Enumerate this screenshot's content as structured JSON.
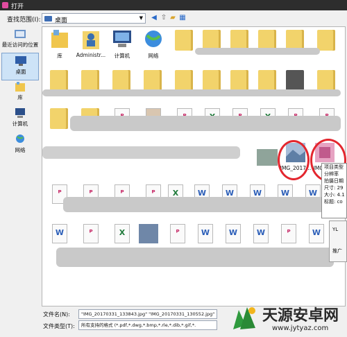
{
  "window": {
    "title": "打开"
  },
  "toolbar": {
    "look_in_label": "查找范围(I):",
    "look_in_value": "桌面",
    "icons": [
      "back-icon",
      "up-folder-icon",
      "new-folder-icon",
      "view-menu-icon"
    ]
  },
  "places": [
    {
      "label": "最近访问的位置",
      "icon": "recent-places-icon"
    },
    {
      "label": "桌面",
      "icon": "desktop-icon",
      "selected": true
    },
    {
      "label": "库",
      "icon": "libraries-icon"
    },
    {
      "label": "计算机",
      "icon": "computer-icon"
    },
    {
      "label": "网络",
      "icon": "network-icon"
    }
  ],
  "files": {
    "row1": [
      {
        "label": "库",
        "icon": "libraries-icon"
      },
      {
        "label": "Administr...",
        "icon": "user-folder-icon"
      },
      {
        "label": "计算机",
        "icon": "computer-icon"
      },
      {
        "label": "网络",
        "icon": "network-icon"
      }
    ],
    "image_1": {
      "label": "IMG_2017...",
      "icon": "image-file-icon"
    },
    "image_2": {
      "label": "IMG_201",
      "icon": "image-file-icon"
    },
    "tooltip_lines": [
      "项目类型",
      "分辨率",
      "拍摄日期",
      "尺寸: 29",
      "大小: 4.1",
      "标题: co"
    ],
    "context_menu": [
      "YL",
      "推广"
    ]
  },
  "footer": {
    "filename_label": "文件名(N):",
    "filename_value": "\"IMG_20170331_133843.jpg\" \"IMG_20170331_130552.jpg\"",
    "filetype_label": "文件类型(T):",
    "filetype_value": "所有支持的格式 (*.pdf,*.dwg,*.bmp,*.rle,*.dib,*.gif,*."
  },
  "watermark": {
    "text": "天源安卓网",
    "url": "www.jytyaz.com"
  },
  "colors": {
    "highlight_circle": "#e3262e",
    "folder": "#f2d36b",
    "pdf": "#c2185b",
    "excel": "#1f7a3a",
    "word": "#2b5eb8"
  }
}
